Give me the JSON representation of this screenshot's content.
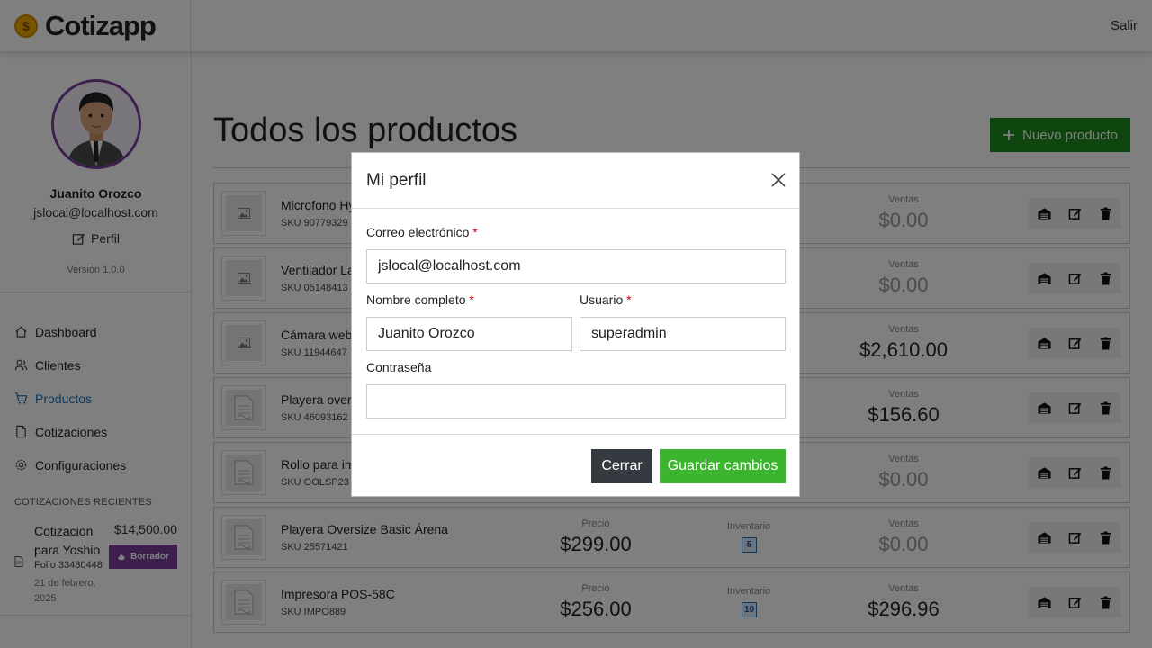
{
  "header": {
    "brand": "Cotizapp",
    "brand_icon": "$",
    "logout_label": "Salir"
  },
  "sidebar": {
    "user_name": "Juanito Orozco",
    "user_email": "jslocal@localhost.com",
    "profile_label": "Perfil",
    "version": "Versión 1.0.0",
    "nav": [
      {
        "label": "Dashboard",
        "icon": "home-icon"
      },
      {
        "label": "Clientes",
        "icon": "users-icon"
      },
      {
        "label": "Productos",
        "icon": "cart-icon",
        "active": true
      },
      {
        "label": "Cotizaciones",
        "icon": "file-icon"
      },
      {
        "label": "Configuraciones",
        "icon": "gear-icon"
      }
    ],
    "recent_title": "COTIZACIONES RECIENTES",
    "recent": {
      "name": "Cotizacion para Yoshio",
      "amount": "$14,500.00",
      "badge": "Borrador",
      "folio": "Folio 33480448",
      "date": "21 de febrero, 2025"
    }
  },
  "main": {
    "title": "Todos los productos",
    "new_button": "Nuevo producto",
    "labels": {
      "price": "Precio",
      "stock": "Inventario",
      "sales": "Ventas"
    },
    "products": [
      {
        "name": "Microfono Hy",
        "sku": "SKU 90779329",
        "sales": "$0.00",
        "thumb": "image"
      },
      {
        "name": "Ventilador La",
        "sku": "SKU 05148413",
        "sales": "$0.00",
        "thumb": "image"
      },
      {
        "name": "Cámara web l",
        "sku": "SKU 11944647",
        "sales": "$2,610.00",
        "thumb": "image"
      },
      {
        "name": "Playera overs",
        "sku": "SKU 46093162",
        "sales": "$156.60",
        "thumb": "doc"
      },
      {
        "name": "Rollo para imp",
        "sku": "SKU OOLSP23",
        "sales": "$0.00",
        "thumb": "doc"
      },
      {
        "name": "Playera Oversize Basic Árena",
        "sku": "SKU 25571421",
        "price": "$299.00",
        "stock": "5",
        "sales": "$0.00",
        "thumb": "doc"
      },
      {
        "name": "Impresora POS-58C",
        "sku": "SKU IMPO889",
        "price": "$256.00",
        "stock": "10",
        "sales": "$296.96",
        "thumb": "doc"
      }
    ]
  },
  "modal": {
    "title": "Mi perfil",
    "email_label": "Correo electrónico",
    "email_value": "jslocal@localhost.com",
    "fullname_label": "Nombre completo",
    "fullname_value": "Juanito Orozco",
    "user_label": "Usuario",
    "user_value": "superadmin",
    "password_label": "Contraseña",
    "password_value": "",
    "required_mark": "*",
    "close_button": "Cerrar",
    "save_button": "Guardar cambios"
  },
  "colors": {
    "accent_green": "#1f8c1f",
    "save_green": "#3cb52e",
    "purple": "#7b3f9a",
    "link_blue": "#1f6fb2"
  }
}
